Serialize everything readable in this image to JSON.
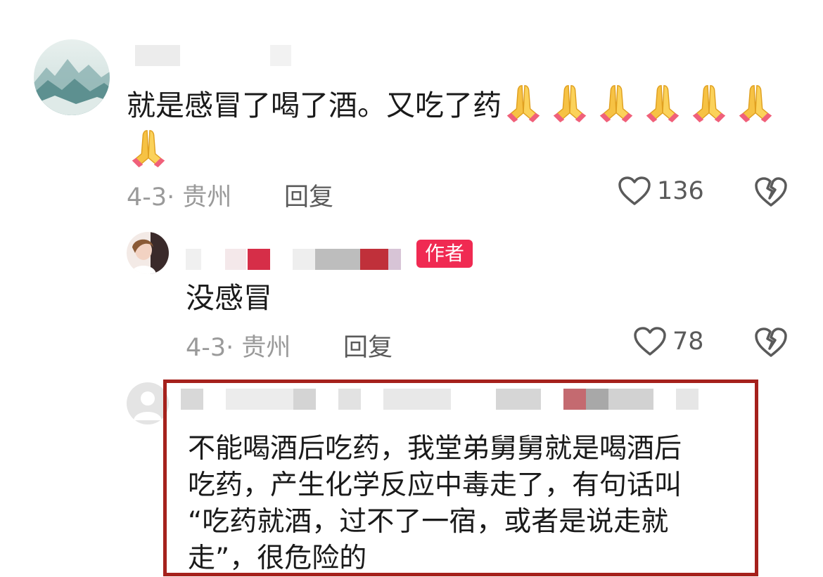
{
  "comments": [
    {
      "text": "就是感冒了喝了酒。又吃了药",
      "emoji_count": 7,
      "emoji_icon": "folded-hands-emoji",
      "date_location": "4-3· 贵州",
      "reply_label": "回复",
      "likes": "136"
    },
    {
      "badge": "作者",
      "text": "没感冒",
      "date_location": "4-3· 贵州",
      "reply_label": "回复",
      "likes": "78"
    },
    {
      "lines": [
        "不能喝酒后吃药，我堂弟舅舅就是喝酒后",
        "吃药，产生化学反应中毒走了，有句话叫",
        "“吃药就酒，过不了一宿，或者是说走就",
        "走”，很危险的"
      ]
    }
  ],
  "colors": {
    "badge": "#f02a52",
    "highlight_border": "#a5211c",
    "meta_text": "#9a9a9a"
  }
}
